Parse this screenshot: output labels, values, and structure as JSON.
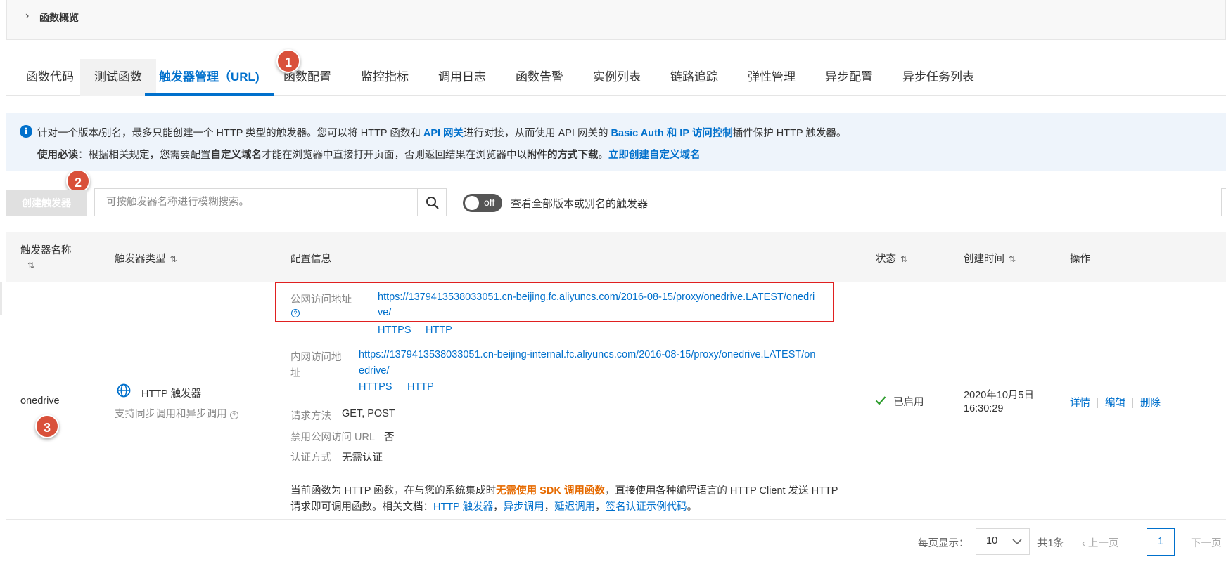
{
  "overview": {
    "title": "函数概览"
  },
  "tabs": [
    {
      "label": "函数代码"
    },
    {
      "label": "测试函数"
    },
    {
      "label": "触发器管理（URL)"
    },
    {
      "label": "函数配置"
    },
    {
      "label": "监控指标"
    },
    {
      "label": "调用日志"
    },
    {
      "label": "函数告警"
    },
    {
      "label": "实例列表"
    },
    {
      "label": "链路追踪"
    },
    {
      "label": "弹性管理"
    },
    {
      "label": "异步配置"
    },
    {
      "label": "异步任务列表"
    }
  ],
  "badges": [
    "1",
    "2",
    "3"
  ],
  "notice": {
    "l1_a": "针对一个版本/别名，最多只能创建一个 HTTP 类型的触发器。您可以将 HTTP 函数和 ",
    "l1_api": "API 网关",
    "l1_b": "进行对接，从而使用 API 网关的 ",
    "l1_basic": "Basic Auth 和 IP 访问控制",
    "l1_c": "插件保护 HTTP 触发器。",
    "l2_bold": "使用必读",
    "l2_a": "：根据相关规定，您需要配置",
    "l2_domain": "自定义域名",
    "l2_b": "才能在浏览器中直接打开页面，否则返回结果在浏览器中以",
    "l2_attach": "附件的方式下载",
    "l2_c": "。",
    "l2_link": "立即创建自定义域名"
  },
  "toolbar": {
    "create_label": "创建触发器",
    "search_placeholder": "可按触发器名称进行模糊搜索。",
    "toggle_text": "off",
    "toggle_label": "查看全部版本或别名的触发器"
  },
  "table": {
    "headers": {
      "name": "触发器名称",
      "type": "触发器类型",
      "config": "配置信息",
      "status": "状态",
      "created": "创建时间",
      "ops": "操作"
    },
    "sort_icon": "⇅",
    "row": {
      "name": "onedrive",
      "type": "HTTP 触发器",
      "type_desc": "支持同步调用和异步调用",
      "public_label": "公网访问地址",
      "public_url_1": "https://1379413538033051.cn-beijing.fc.aliyuncs.com/2016-08-15/proxy/onedrive.LATEST/onedri",
      "public_url_2": "ve/",
      "internal_label_1": "内网访问地",
      "internal_label_2": "址",
      "internal_url_1": "https://1379413538033051.cn-beijing-internal.fc.aliyuncs.com/2016-08-15/proxy/onedrive.LATEST/on",
      "internal_url_2": "edrive/",
      "https": "HTTPS",
      "http": "HTTP",
      "method_label": "请求方法",
      "method_value": "GET, POST",
      "disable_label": "禁用公网访问 URL",
      "disable_value": "否",
      "auth_label": "认证方式",
      "auth_value": "无需认证",
      "desc1_a": "当前函数为 HTTP 函数，在与您的系统集成时",
      "desc1_b": "无需使用 SDK 调用函数",
      "desc1_c": "，直接使用各种编程语言的 HTTP Client 发送 HTTP",
      "desc2_a": "请求即可调用函数。相关文档：",
      "doc_http": "HTTP 触发器",
      "doc_async": "异步调用",
      "doc_delay": "延迟调用",
      "doc_sign": "签名认证示例代码",
      "sep": "，",
      "end": "。",
      "status": "已启用",
      "created_date": "2020年10月5日",
      "created_time": "16:30:29",
      "op_detail": "详情",
      "op_edit": "编辑",
      "op_delete": "删除"
    }
  },
  "pagination": {
    "per_page_label": "每页显示：",
    "per_page_value": "10",
    "total": "共1条",
    "prev": "上一页",
    "current": "1",
    "next": "下一页"
  },
  "colors": {
    "accent": "#0070cc",
    "badge": "#d9503a",
    "highlight_box": "#e02020",
    "warning": "#e66a00",
    "success": "#2e9d2e"
  }
}
